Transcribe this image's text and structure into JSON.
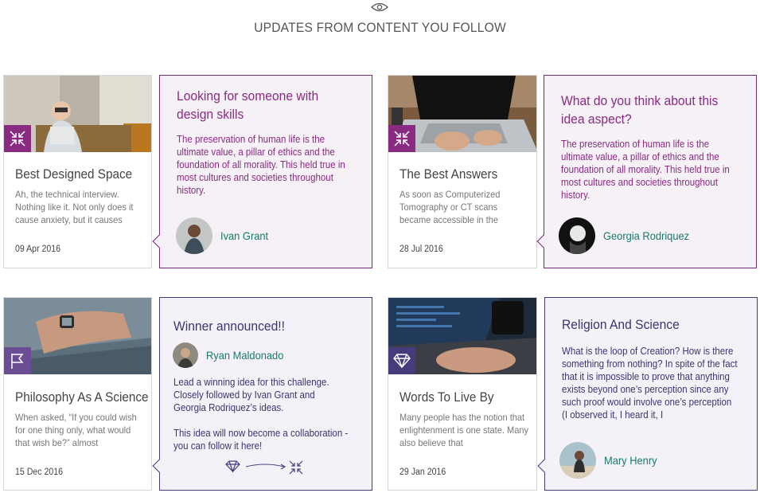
{
  "header": {
    "title": "UPDATES FROM CONTENT YOU FOLLOW",
    "icon": "eye-icon"
  },
  "colors": {
    "purple": "#8a2b82",
    "dark_purple": "#463c7c",
    "teal": "#187a6a"
  },
  "cards": [
    {
      "title": "Best Designed Space",
      "excerpt": "Ah, the technical interview. Nothing like it. Not only does it cause anxiety, but it causes",
      "date": "09 Apr 2016",
      "badge_icon": "collapse-arrows-icon"
    },
    {
      "title": "The Best Answers",
      "excerpt": "As soon as Computerized Tomography or CT scans became accessible in the",
      "date": "28 Jul 2016",
      "badge_icon": "collapse-arrows-icon"
    },
    {
      "title": "Philosophy As A Science",
      "excerpt": "When asked, “If you could wish for one thing only, what would that wish be?” almost",
      "date": "15 Dec 2016",
      "badge_icon": "flag-icon"
    },
    {
      "title": "Words To Live By",
      "excerpt": "Many people has the notion that enlightenment is one state. Many also believe that",
      "date": "29 Jan 2016",
      "badge_icon": "diamond-icon"
    }
  ],
  "panels": [
    {
      "title": "Looking for someone with design skills",
      "body": "The preservation of human life is the ultimate value, a pillar of ethics and the foundation of all morality. This held true in most cultures and societies throughout history.",
      "author": "Ivan Grant"
    },
    {
      "title": "What do you think about this idea aspect?",
      "body": "The preservation of human life is the ultimate value, a pillar of ethics and the foundation of all morality. This held true in most cultures and societies throughout history.",
      "author": "Georgia Rodriquez"
    },
    {
      "title": "Winner announced!!",
      "author": "Ryan Maldonado",
      "body": "Lead a winning idea for this challenge. Closely followed by Ivan Grant and Georgia Rodriquez’s ideas.",
      "body2": "This idea will now become a collaboration - you can follow it here!"
    },
    {
      "title": "Religion And Science",
      "body": "What is the loop of Creation? How is there something from nothing? In spite of the fact that it is impossible to prove that anything exists beyond one’s perception since any such proof would involve one’s perception (I observed it, I heard it, I",
      "author": "Mary Henry"
    }
  ]
}
